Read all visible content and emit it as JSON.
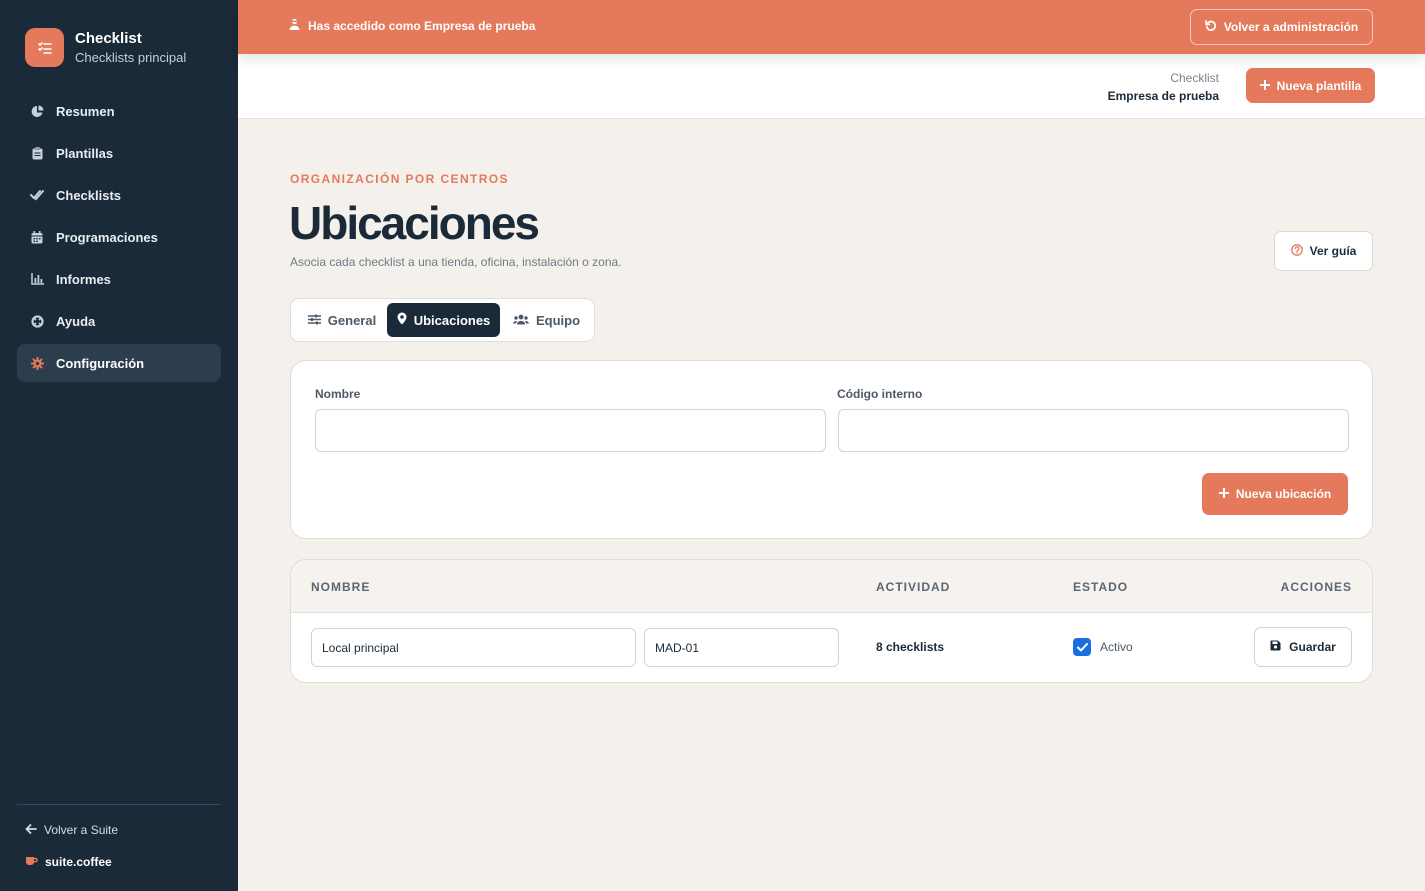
{
  "sidebar": {
    "brand_title": "Checklist",
    "brand_subtitle": "Checklists principal",
    "items": [
      {
        "label": "Resumen",
        "icon": "pie-chart-icon"
      },
      {
        "label": "Plantillas",
        "icon": "clipboard-icon"
      },
      {
        "label": "Checklists",
        "icon": "double-check-icon"
      },
      {
        "label": "Programaciones",
        "icon": "calendar-icon"
      },
      {
        "label": "Informes",
        "icon": "bar-chart-icon"
      },
      {
        "label": "Ayuda",
        "icon": "life-ring-icon"
      },
      {
        "label": "Configuración",
        "icon": "gear-icon",
        "active": true
      }
    ],
    "back_suite": "Volver a Suite",
    "suite_brand": "suite.coffee"
  },
  "banner": {
    "message": "Has accedido como Empresa de prueba",
    "back_admin": "Volver a administración"
  },
  "header": {
    "app_name": "Checklist",
    "company": "Empresa de prueba",
    "new_template": "Nueva plantilla"
  },
  "page": {
    "eyebrow": "ORGANIZACIÓN POR CENTROS",
    "title": "Ubicaciones",
    "description": "Asocia cada checklist a una tienda, oficina, instalación o zona.",
    "guide_button": "Ver guía"
  },
  "tabs": [
    {
      "label": "General",
      "icon": "sliders-icon"
    },
    {
      "label": "Ubicaciones",
      "icon": "map-pin-icon",
      "active": true
    },
    {
      "label": "Equipo",
      "icon": "users-icon"
    }
  ],
  "form": {
    "name_label": "Nombre",
    "name_value": "",
    "code_label": "Código interno",
    "code_value": "",
    "add_button": "Nueva ubicación"
  },
  "table": {
    "headers": [
      "NOMBRE",
      "ACTIVIDAD",
      "ESTADO",
      "ACCIONES"
    ],
    "rows": [
      {
        "name": "Local principal",
        "code": "MAD-01",
        "activity": "8 checklists",
        "status": "Activo",
        "active": true,
        "save": "Guardar"
      }
    ]
  },
  "colors": {
    "accent": "#e5795b",
    "sidebar": "#1b2a38",
    "background": "#f4f1ec",
    "checkbox": "#1a6fe0"
  }
}
